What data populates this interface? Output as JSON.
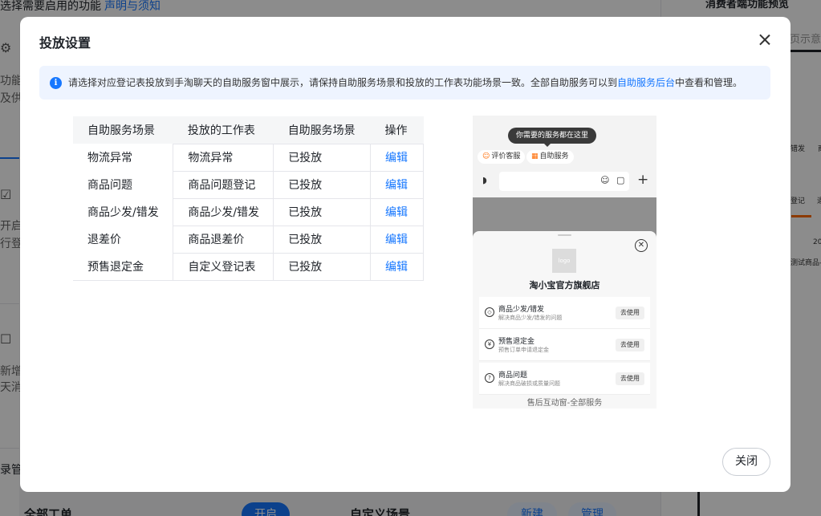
{
  "background": {
    "top_title": "选择需要启用的功能",
    "top_link": "声明与须知",
    "right_title": "消费者端功能预览",
    "right_sub": "页示意",
    "phone_text_1": "错发",
    "phone_text_2": "商",
    "phone_text_3": "登记",
    "phone_text_4": "退",
    "phone_text_5": "20",
    "phone_text_6": "测试商品-",
    "left_texts": [
      "功能",
      "及供",
      "开启",
      "行登",
      "新增",
      "天消",
      "录管"
    ],
    "bottom_left_title": "全部工单",
    "bottom_left_btn": "开启",
    "bottom_mid_title": "自定义场景",
    "bottom_mid_btn1": "新建",
    "bottom_mid_btn2": "管理"
  },
  "modal": {
    "title": "投放设置",
    "notice": {
      "text_before": "请选择对应登记表投放到手淘聊天的自助服务窗中展示，请保持自助服务场景和投放的工作表功能场景一致。全部自助服务可以到",
      "link": "自助服务后台",
      "text_after": "中查看和管理。"
    },
    "table": {
      "headers": [
        "自助服务场景",
        "投放的工作表",
        "自助服务场景",
        "操作"
      ],
      "rows": [
        {
          "scene": "物流异常",
          "sheet": "物流异常",
          "status": "已投放",
          "action": "编辑"
        },
        {
          "scene": "商品问题",
          "sheet": "商品问题登记",
          "status": "已投放",
          "action": "编辑"
        },
        {
          "scene": "商品少发/错发",
          "sheet": "商品少发/错发",
          "status": "已投放",
          "action": "编辑"
        },
        {
          "scene": "退差价",
          "sheet": "商品退差价",
          "status": "已投放",
          "action": "编辑"
        },
        {
          "scene": "预售退定金",
          "sheet": "自定义登记表",
          "status": "已投放",
          "action": "编辑"
        }
      ]
    },
    "preview": {
      "tip": "你需要的服务都在这里",
      "chip1": "评价客服",
      "chip2": "自助服务",
      "logo": "logo",
      "shop_name": "淘小宝官方旗舰店",
      "items": [
        {
          "title": "商品少发/错发",
          "sub": "解决商品少发/错发的问题",
          "btn": "去使用"
        },
        {
          "title": "预售退定金",
          "sub": "预售订单申请退定金",
          "btn": "去使用"
        },
        {
          "title": "商品问题",
          "sub": "解决商品破损或质量问题",
          "btn": "去使用"
        }
      ],
      "footer": "售后互动窗-全部服务"
    },
    "close_label": "关闭"
  },
  "colors": {
    "accent": "#1677ff",
    "brand_orange": "#ff6a00",
    "notice_bg": "#eef4ff"
  }
}
